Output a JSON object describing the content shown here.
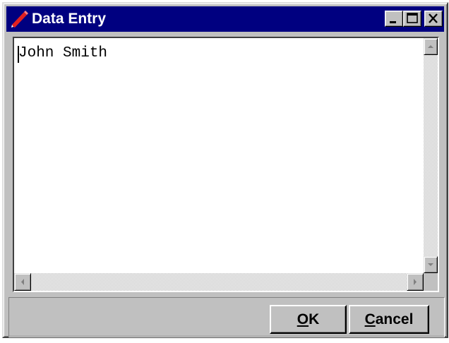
{
  "window": {
    "title": "Data Entry",
    "icon": "pencil-icon"
  },
  "titlebar_buttons": {
    "minimize_icon": "minimize-icon",
    "maximize_icon": "maximize-icon",
    "close_icon": "close-icon"
  },
  "editor": {
    "value": "John Smith"
  },
  "buttons": {
    "ok": {
      "mnemonic": "O",
      "rest": "K"
    },
    "cancel": {
      "mnemonic": "C",
      "rest": "ancel"
    }
  },
  "colors": {
    "titlebar": "#000080",
    "face": "#c0c0c0",
    "pencil": "#e02020"
  }
}
